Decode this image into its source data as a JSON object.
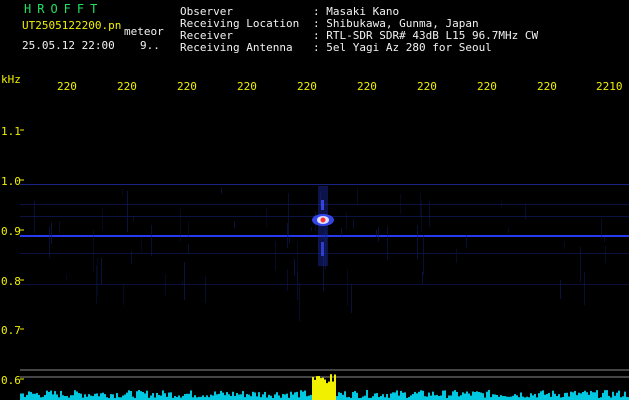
{
  "header": {
    "app_name": "HROFFT",
    "filename": "UT2505122200.pn",
    "event": "meteor",
    "datetime": "25.05.12 22:00",
    "count": "9..",
    "fields": [
      {
        "label": "Observer",
        "value": ": Masaki Kano"
      },
      {
        "label": "Receiving Location",
        "value": ": Shibukawa, Gunma, Japan"
      },
      {
        "label": "Receiver",
        "value": ": RTL-SDR SDR# 43dB L15 96.7MHz CW"
      },
      {
        "label": "Receiving Antenna",
        "value": ": 5el Yagi Az 280 for Seoul"
      }
    ]
  },
  "axis": {
    "y_unit": "kHz",
    "y_ticks": [
      "1.1",
      "1.0",
      "0.9",
      "0.8",
      "0.7",
      "0.6"
    ],
    "x_ticks": [
      "220",
      "220",
      "220",
      "220",
      "220",
      "220",
      "220",
      "220",
      "220",
      "2210"
    ]
  },
  "colors": {
    "text_yellow": "#f0f000",
    "text_green": "#20e060",
    "signal_blue": "#2a3cff",
    "noise_cyan": "#00c8e0",
    "burst_red": "#ff3030"
  }
}
